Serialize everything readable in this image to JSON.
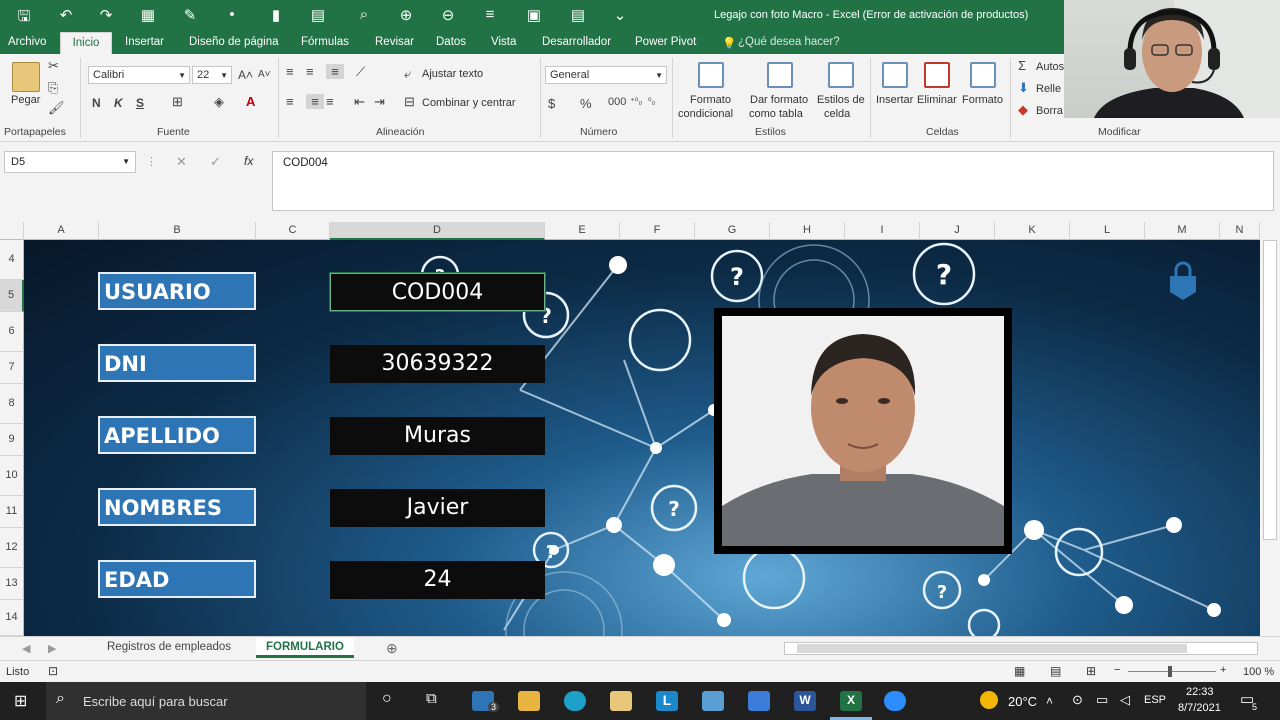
{
  "window": {
    "title": "Legajo con foto Macro - Excel (Error de activación de productos)"
  },
  "menu": {
    "items": [
      "Archivo",
      "Inicio",
      "Insertar",
      "Diseño de página",
      "Fórmulas",
      "Revisar",
      "Datos",
      "Vista",
      "Desarrollador",
      "Power Pivot"
    ],
    "active": "Inicio",
    "tell_me": "¿Qué desea hacer?"
  },
  "ribbon": {
    "pegar": "Pegar",
    "portapapeles": "Portapapeles",
    "font_name": "Calibri",
    "font_size": "22",
    "fuente": "Fuente",
    "ajustar": "Ajustar texto",
    "combinar": "Combinar y centrar",
    "alineacion": "Alineación",
    "number_format": "General",
    "numero": "Número",
    "formato_cond_1": "Formato",
    "formato_cond_2": "condicional",
    "dar_formato_1": "Dar formato",
    "dar_formato_2": "como tabla",
    "estilos_celda_1": "Estilos de",
    "estilos_celda_2": "celda",
    "estilos": "Estilos",
    "insertar": "Insertar",
    "eliminar": "Eliminar",
    "formato": "Formato",
    "celdas": "Celdas",
    "autosuma": "Autos",
    "rellenar": "Relle",
    "borrar": "Borra",
    "modificar": "Modificar",
    "bold": "N",
    "italic": "K",
    "underline": "S"
  },
  "formula_bar": {
    "name_box": "D5",
    "fx": "fx",
    "content": "COD004"
  },
  "columns": [
    "A",
    "B",
    "C",
    "D",
    "E",
    "F",
    "G",
    "H",
    "I",
    "J",
    "K",
    "L",
    "M",
    "N"
  ],
  "rows": [
    "4",
    "5",
    "6",
    "7",
    "8",
    "9",
    "10",
    "11",
    "12",
    "13",
    "14"
  ],
  "form": {
    "fields": [
      {
        "label": "USUARIO",
        "value": "COD004"
      },
      {
        "label": "DNI",
        "value": "30639322"
      },
      {
        "label": "APELLIDO",
        "value": "Muras"
      },
      {
        "label": "NOMBRES",
        "value": "Javier"
      },
      {
        "label": "EDAD",
        "value": "24"
      }
    ]
  },
  "sheet_tabs": {
    "tabs": [
      "Registros de empleados",
      "FORMULARIO"
    ],
    "active": "FORMULARIO"
  },
  "status": {
    "ready": "Listo",
    "zoom": "100 %"
  },
  "taskbar": {
    "search_placeholder": "Escribe aquí para buscar",
    "temperature": "20°C",
    "language": "ESP",
    "time": "22:33",
    "date": "8/7/2021",
    "mail_badge": "3",
    "notif_badge": "5"
  },
  "colors": {
    "excel_green": "#217346",
    "label_blue": "#2e75b6",
    "value_black": "#0c0c0c"
  }
}
